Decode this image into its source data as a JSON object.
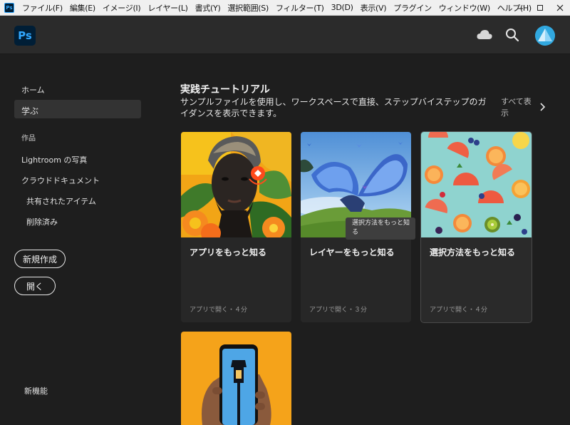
{
  "menubar": {
    "app_icon": "Ps",
    "items": [
      "ファイル(F)",
      "編集(E)",
      "イメージ(I)",
      "レイヤー(L)",
      "書式(Y)",
      "選択範囲(S)",
      "フィルター(T)",
      "3D(D)",
      "表示(V)",
      "プラグイン",
      "ウィンドウ(W)",
      "ヘルプ(H)"
    ],
    "window_controls": [
      "minimize-icon",
      "maximize-icon",
      "close-icon"
    ]
  },
  "header": {
    "logo_text": "Ps",
    "icons": [
      "cloud-icon",
      "search-icon",
      "avatar"
    ],
    "brand_color": "#31a8ff"
  },
  "sidebar": {
    "home": "ホーム",
    "learn": "学ぶ",
    "works_heading": "作品",
    "lightroom": "Lightroom の写真",
    "cloud_docs": "クラウドドキュメント",
    "shared": "共有されたアイテム",
    "deleted": "削除済み",
    "new_button": "新規作成",
    "open_button": "開く",
    "whats_new": "新機能"
  },
  "main": {
    "section_title": "実践チュートリアル",
    "section_desc": "サンプルファイルを使用し、ワークスペースで直接、ステップバイステップのガイダンスを表示できます。",
    "show_all": "すべて表示",
    "cards": [
      {
        "title": "アプリをもっと知る",
        "meta": "アプリで開く・４分"
      },
      {
        "title": "レイヤーをもっと知る",
        "meta": "アプリで開く・３分"
      },
      {
        "title": "選択方法をもっと知る",
        "meta": "アプリで開く・４分"
      }
    ],
    "tooltip": "選択方法をもっと知る"
  }
}
